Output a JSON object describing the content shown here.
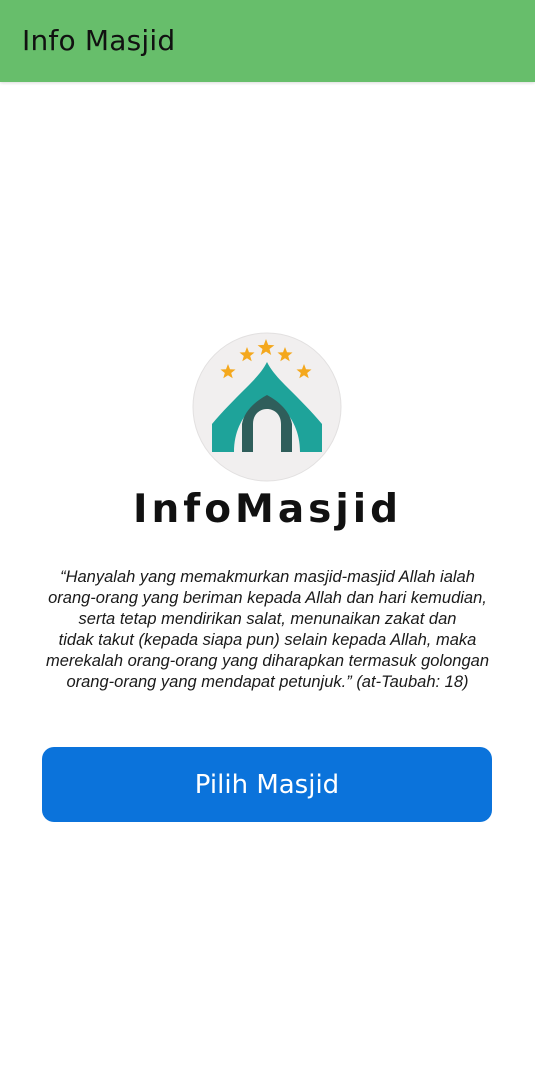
{
  "app_bar": {
    "title": "Info Masjid",
    "background_color": "#67be6b"
  },
  "logo": {
    "icon": "mosque-icon",
    "colors": {
      "circle_background": "#f1efef",
      "dome": "#1ea39a",
      "door": "#2f5e5b",
      "stars": "#f4a81d"
    }
  },
  "brand": {
    "name": "InfoMasjid"
  },
  "quote": {
    "lines": [
      "“Hanyalah yang memakmurkan masjid-masjid Allah ialah",
      "orang-orang yang beriman kepada Allah dan hari kemudian,",
      "serta tetap mendirikan salat, menunaikan zakat dan",
      "tidak takut (kepada siapa pun) selain kepada Allah, maka",
      "merekalah orang-orang yang diharapkan termasuk golongan",
      "orang-orang yang mendapat petunjuk.” (at-Taubah: 18)"
    ]
  },
  "primary_button": {
    "label": "Pilih Masjid",
    "color": "#0b73db"
  }
}
